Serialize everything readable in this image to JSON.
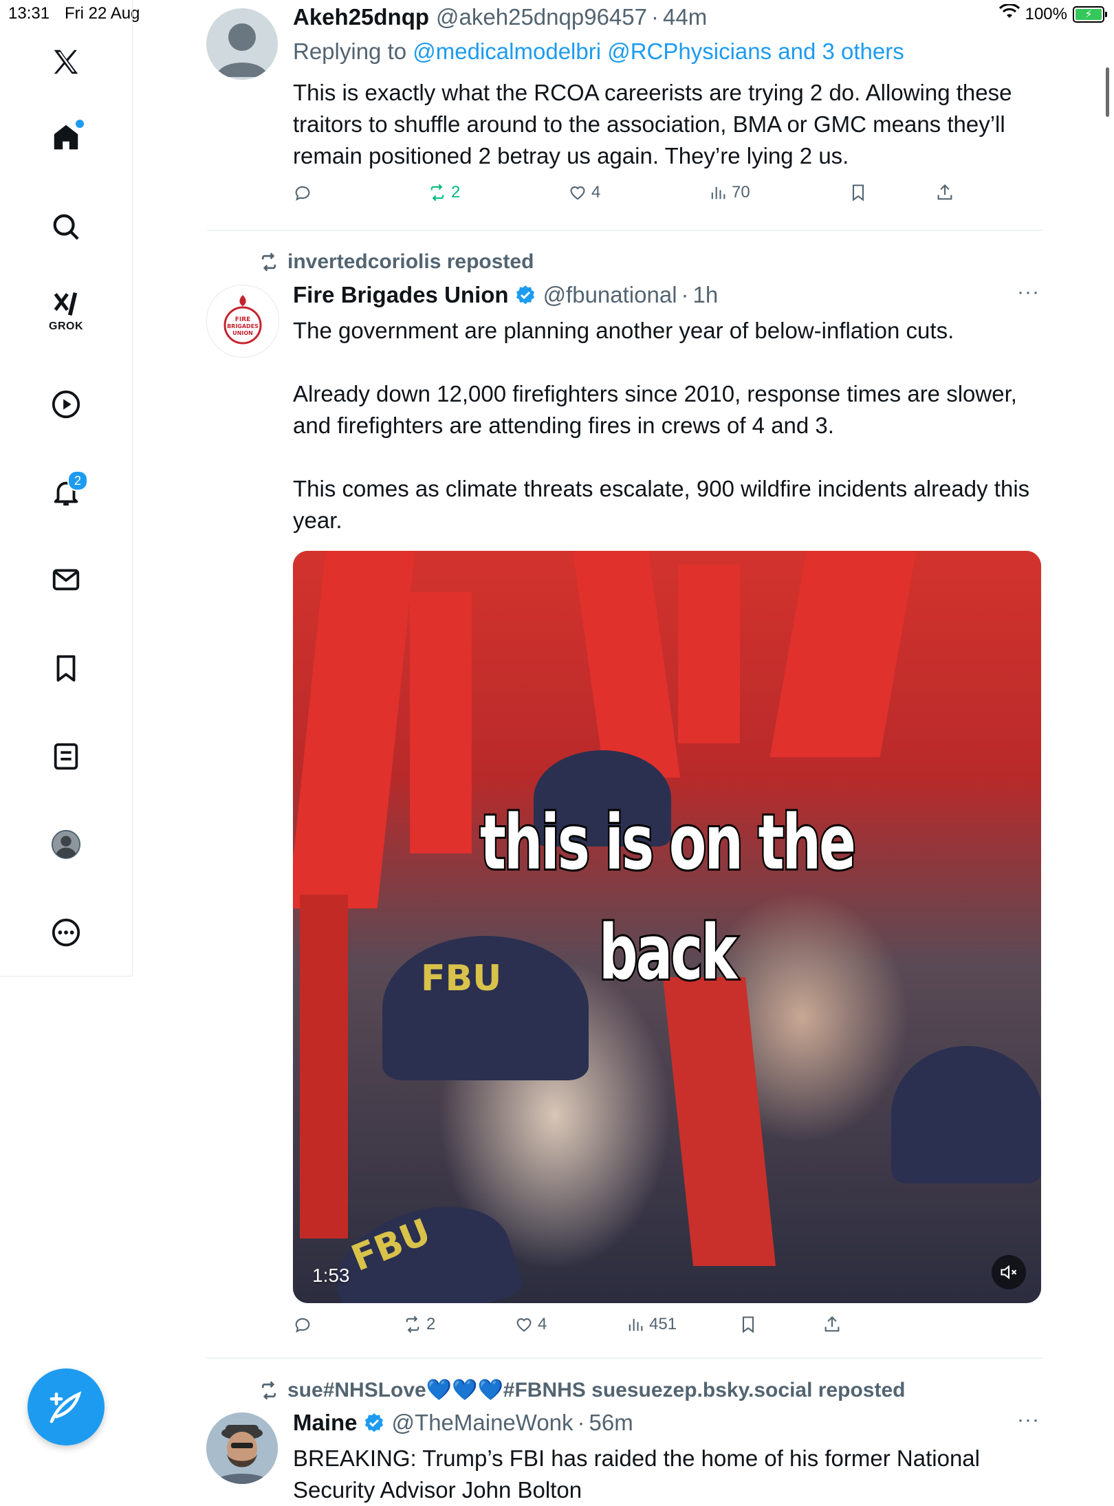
{
  "status_bar": {
    "time": "13:31",
    "date": "Fri 22 Aug",
    "battery": "100%",
    "icons": [
      "wifi-icon",
      "battery-charging-icon"
    ]
  },
  "sidebar": {
    "items": [
      {
        "name": "x-logo",
        "icon": "x-logo-icon"
      },
      {
        "name": "home",
        "icon": "home-icon"
      },
      {
        "name": "search",
        "icon": "search-icon"
      },
      {
        "name": "grok",
        "icon": "grok-icon",
        "label": "GROK"
      },
      {
        "name": "video",
        "icon": "play-icon"
      },
      {
        "name": "notifications",
        "icon": "bell-icon",
        "badge": "2"
      },
      {
        "name": "messages",
        "icon": "mail-icon"
      },
      {
        "name": "bookmarks",
        "icon": "bookmark-icon"
      },
      {
        "name": "lists",
        "icon": "list-icon"
      },
      {
        "name": "profile",
        "icon": "profile-icon"
      },
      {
        "name": "more",
        "icon": "more-circle-icon"
      }
    ],
    "compose_icon": "compose-icon"
  },
  "tweets": [
    {
      "name": "Akeh25dnqp",
      "handle": "@akeh25dnqp96457",
      "time": "44m",
      "replying_prefix": "Replying to",
      "replying_to": "@medicalmodelbri @RCPhysicians and 3 others",
      "text": "This is exactly what the RCOA careerists are trying 2 do. Allowing these traitors to shuffle around to the association, BMA or GMC means they’ll remain positioned 2 betray us again. They’re lying 2 us.",
      "replies": "",
      "reposts": "2",
      "likes": "4",
      "views": "70"
    },
    {
      "repost_label": "invertedcoriolis reposted",
      "name": "Fire Brigades Union",
      "handle": "@fbunational",
      "time": "1h",
      "avatar_text": "FIRE BRIGADES UNION",
      "text_1": "The government are planning another year of below-inflation cuts.",
      "text_2": "Already down 12,000 firefighters since 2010, response times are slower, and firefighters are attending fires in crews of 4 and 3.",
      "text_3": "This comes as climate threats escalate, 900 wildfire incidents already this year.",
      "media": {
        "caption_line1": "this is on the",
        "caption_line2": "back",
        "duration": "1:53",
        "beanie_text": "FBU"
      },
      "replies": "",
      "reposts": "2",
      "likes": "4",
      "views": "451"
    },
    {
      "repost_label": "sue#NHSLove💙💙💙#FBNHS suesuezep.bsky.social reposted",
      "name": "Maine",
      "handle": "@TheMaineWonk",
      "time": "56m",
      "text": "BREAKING: Trump’s FBI has raided the home of his former National Security Advisor John Bolton"
    }
  ],
  "colors": {
    "accent": "#1d9bf0",
    "secondary_text": "#536471",
    "repost_green": "#00ba7c",
    "divider": "#eff3f4"
  }
}
